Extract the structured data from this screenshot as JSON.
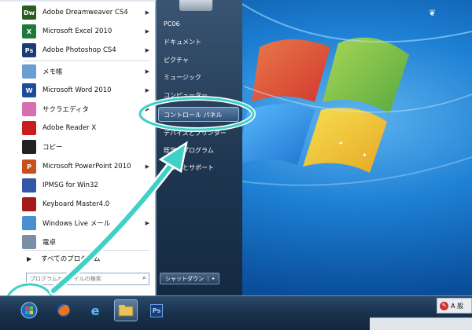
{
  "start_menu": {
    "programs": [
      {
        "label": "Adobe Dreamweaver CS4",
        "icon": "dreamweaver-icon",
        "icon_text": "Dw",
        "color": "#2a5d1f",
        "submenu": true
      },
      {
        "label": "Microsoft Excel 2010",
        "icon": "excel-icon",
        "icon_text": "X",
        "color": "#1f7a3a",
        "submenu": true
      },
      {
        "label": "Adobe Photoshop CS4",
        "icon": "photoshop-icon",
        "icon_text": "Ps",
        "color": "#1a3d7a",
        "submenu": true
      },
      {
        "label": "メモ帳",
        "icon": "notepad-icon",
        "icon_text": "",
        "color": "#6a9ed1",
        "submenu": true
      },
      {
        "label": "Microsoft Word 2010",
        "icon": "word-icon",
        "icon_text": "W",
        "color": "#1b4d9e",
        "submenu": true
      },
      {
        "label": "サクラエディタ",
        "icon": "sakura-editor-icon",
        "icon_text": "",
        "color": "#d46fb0",
        "submenu": true
      },
      {
        "label": "Adobe Reader X",
        "icon": "adobe-reader-icon",
        "icon_text": "",
        "color": "#c81e1e",
        "submenu": false
      },
      {
        "label": "コピー",
        "icon": "copy-icon",
        "icon_text": "",
        "color": "#222222",
        "submenu": false
      },
      {
        "label": "Microsoft PowerPoint 2010",
        "icon": "powerpoint-icon",
        "icon_text": "P",
        "color": "#c8501e",
        "submenu": true
      },
      {
        "label": "IPMSG for Win32",
        "icon": "ipmsg-icon",
        "icon_text": "",
        "color": "#3555a8",
        "submenu": false
      },
      {
        "label": "Keyboard Master4.0",
        "icon": "keyboard-master-icon",
        "icon_text": "",
        "color": "#a31c1c",
        "submenu": false
      },
      {
        "label": "Windows Live メール",
        "icon": "windows-live-mail-icon",
        "icon_text": "",
        "color": "#4b8fd1",
        "submenu": true
      },
      {
        "label": "電卓",
        "icon": "calculator-icon",
        "icon_text": "",
        "color": "#7a8ea5",
        "submenu": false
      }
    ],
    "all_programs": "すべてのプログラム",
    "search_placeholder": "プログラムとファイルの検索",
    "right_items": {
      "user": "PC06",
      "documents": "ドキュメント",
      "pictures": "ピクチャ",
      "music": "ミュージック",
      "computer": "コンピューター",
      "control_panel": "コントロール パネル",
      "devices": "デバイスとプリンター",
      "default_programs": "既定のプログラム",
      "help": "ヘルプとサポート"
    },
    "shutdown": "シャットダウン"
  },
  "taskbar": {
    "apps": [
      "start-orb-icon",
      "firefox-icon",
      "internet-explorer-icon",
      "explorer-folder-icon",
      "photoshop-icon"
    ],
    "ime": {
      "icon": "ime-icon",
      "text": "A 般"
    }
  },
  "colors": {
    "highlight": "#3fd0c8",
    "desktop": "#1d7fd3"
  }
}
